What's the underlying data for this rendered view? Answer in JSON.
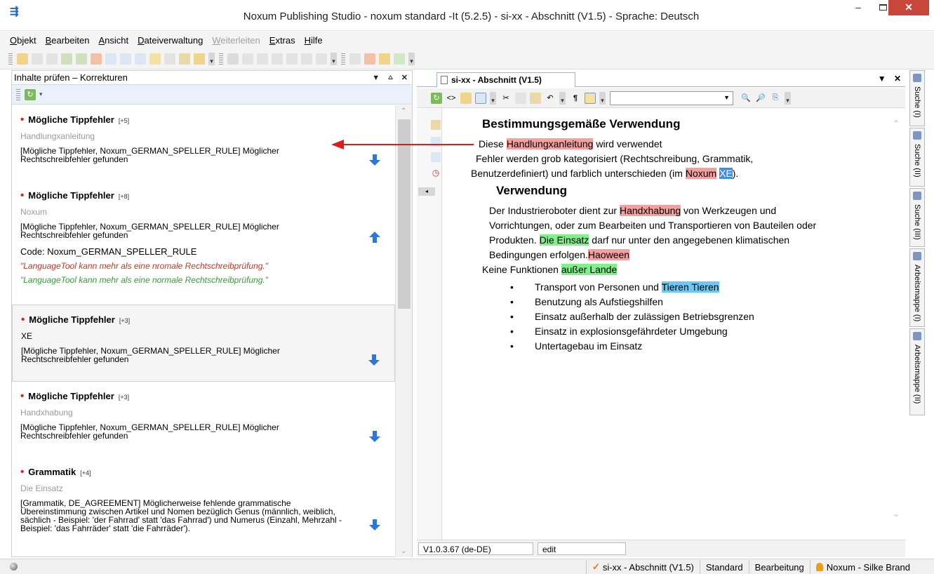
{
  "window": {
    "title": "Noxum Publishing Studio - noxum standard -It (5.2.5) - si-xx - Abschnitt (V1.5) - Sprache: Deutsch",
    "app_icon": "noxum-app-icon"
  },
  "menu": [
    {
      "label": "Objekt",
      "enabled": true
    },
    {
      "label": "Bearbeiten",
      "enabled": true
    },
    {
      "label": "Ansicht",
      "enabled": true
    },
    {
      "label": "Dateiverwaltung",
      "enabled": true
    },
    {
      "label": "Weiterleiten",
      "enabled": false
    },
    {
      "label": "Extras",
      "enabled": true
    },
    {
      "label": "Hilfe",
      "enabled": true
    }
  ],
  "left_pane": {
    "title": "Inhalte prüfen – Korrekturen",
    "issues": [
      {
        "type": "Mögliche Tippfehler",
        "count": "[+5]",
        "word": "Handlungxanleitung",
        "message": "[Mögliche Tippfehler, Noxum_GERMAN_SPELLER_RULE] Möglicher Rechtschreibfehler gefunden",
        "arrow": "down-arrow-icon"
      },
      {
        "type": "Mögliche Tippfehler",
        "count": "[+8]",
        "word": "Noxum",
        "message": "[Mögliche Tippfehler, Noxum_GERMAN_SPELLER_RULE] Möglicher Rechtschreibfehler gefunden",
        "arrow": "up-arrow-icon",
        "code": "Code: Noxum_GERMAN_SPELLER_RULE",
        "suggestion_bad": "\"LanguageTool kann mehr als eine nromale Rechtschreibprüfung.\"",
        "suggestion_good": "\"LanguageTool kann mehr als eine normale Rechtschreibprüfung.\""
      },
      {
        "type": "Mögliche Tippfehler",
        "count": "[+3]",
        "word": "XE",
        "message": "[Mögliche Tippfehler, Noxum_GERMAN_SPELLER_RULE] Möglicher Rechtschreibfehler gefunden",
        "arrow": "down-arrow-icon"
      },
      {
        "type": "Mögliche Tippfehler",
        "count": "[+3]",
        "word": "Handxhabung",
        "message": "[Mögliche Tippfehler, Noxum_GERMAN_SPELLER_RULE] Möglicher Rechtschreibfehler gefunden",
        "arrow": "down-arrow-icon"
      },
      {
        "type": "Grammatik",
        "count": "[+4]",
        "word": "Die Einsatz",
        "message": "[Grammatik, DE_AGREEMENT] Möglicherweise fehlende grammatische Übereinstimmung zwischen Artikel und Nomen bezüglich Genus (männlich, weiblich, sächlich - Beispiel: 'der Fahrrad' statt 'das Fahrrad') und Numerus (Einzahl, Mehrzahl - Beispiel: 'das Fahrräder' statt 'die Fahrräder').",
        "arrow": "down-arrow-icon"
      }
    ]
  },
  "editor": {
    "tab_label": "si-xx - Abschnitt (V1.5)",
    "heading1": "Bestimmungsgemäße Verwendung",
    "line1": {
      "pre": "Diese ",
      "hl": "Handlungxanleitung",
      "post": " wird verwendet"
    },
    "line2": "Fehler werden grob kategorisiert (Rechtschreibung, Grammatik,",
    "line3": {
      "pre": "Benutzerdefiniert) und farblich unterschieden (im ",
      "hl1": "Noxum",
      "sp": " ",
      "hl2": "XE",
      "post": ")."
    },
    "heading2": "Verwendung",
    "para_l1": {
      "pre": "Der Industrieroboter dient zur ",
      "hl": "Handxhabung",
      "post": " von Werkzeugen und"
    },
    "para_l2": "Vorrichtungen, oder zum Bearbeiten und Transportieren von Bauteilen oder",
    "para_l3": {
      "pre": "Produkten. ",
      "hl": "Die Einsatz",
      "post": " darf nur unter den angegebenen klimatischen"
    },
    "para_l4": {
      "pre": "Bedingungen erfolgen.",
      "hl": "Haoween"
    },
    "line_func": {
      "pre": "Keine Funktionen ",
      "hl": "außer Lande"
    },
    "bullets": [
      {
        "pre": "Transport von Personen und ",
        "hl": "Tieren Tieren"
      },
      {
        "pre": "Benutzung als Aufstiegshilfen",
        "hl": ""
      },
      {
        "pre": "Einsatz außerhalb der zulässigen Betriebsgrenzen",
        "hl": ""
      },
      {
        "pre": "Einsatz in explosionsgefährdeter Umgebung",
        "hl": ""
      },
      {
        "pre": "Untertagebau im Einsatz",
        "hl": ""
      }
    ],
    "status_version": "V1.0.3.67 (de-DE)",
    "status_mode": "edit"
  },
  "side_tabs": [
    "Suche (I)",
    "Suche (II)",
    "Suche (III)",
    "Arbeitsmappe (I)",
    "Arbeitsmappe (II)"
  ],
  "statusbar": {
    "doc": "si-xx - Abschnitt (V1.5)",
    "profile": "Standard",
    "mode": "Bearbeitung",
    "user": "Noxum - Silke Brand"
  },
  "colors": {
    "highlight_spelling": "#f4a0a0",
    "highlight_grammar": "#7ff08a",
    "highlight_custom": "#6cc9f2",
    "bullet_red": "#d7261d",
    "arrow_blue": "#2f77d4",
    "annotation_red": "#e01b1b"
  }
}
